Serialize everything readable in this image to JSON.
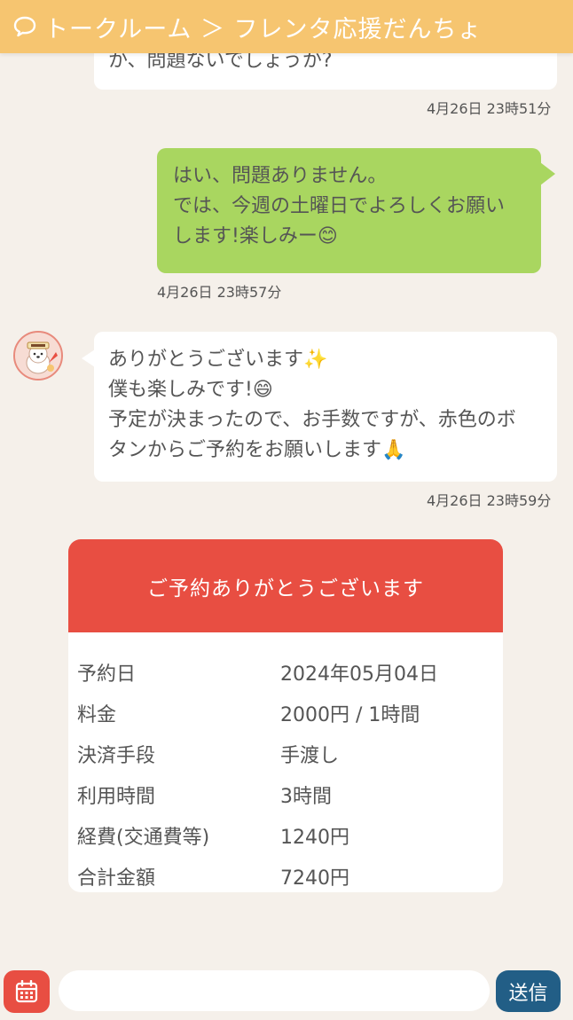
{
  "header": {
    "title": "トークルーム ＞ フレンタ応援だんちょ"
  },
  "messages": [
    {
      "sender": "other",
      "lines": [
        "か、問題ないでしょうか?"
      ],
      "time": "4月26日 23時51分"
    },
    {
      "sender": "me",
      "lines": [
        "はい、問題ありません。",
        "では、今週の土曜日でよろしくお願い",
        "します!楽しみー😊"
      ],
      "time": "4月26日 23時57分"
    },
    {
      "sender": "other",
      "lines": [
        "ありがとうございます✨",
        "僕も楽しみです!😄",
        "予定が決まったので、お手数ですが、赤色のボ",
        "タンからご予約をお願いします🙏"
      ],
      "time": "4月26日 23時59分"
    }
  ],
  "reservation": {
    "title": "ご予約ありがとうございます",
    "rows": [
      {
        "label": "予約日",
        "value": "2024年05月04日"
      },
      {
        "label": "料金",
        "value": "2000円 / 1時間"
      },
      {
        "label": "決済手段",
        "value": "手渡し"
      },
      {
        "label": "利用時間",
        "value": "3時間"
      },
      {
        "label": "経費(交通費等)",
        "value": "1240円"
      },
      {
        "label": "合計金額",
        "value": "7240円"
      }
    ]
  },
  "composer": {
    "input_value": "",
    "send_label": "送信"
  },
  "colors": {
    "header": "#f6c570",
    "background": "#f5f0ea",
    "my_bubble": "#a9d660",
    "accent_red": "#e84e42",
    "send_button": "#225e86"
  },
  "icons": {
    "header": "chat-bubble-icon",
    "calendar": "calendar-icon",
    "avatar": "mascot-avatar"
  }
}
